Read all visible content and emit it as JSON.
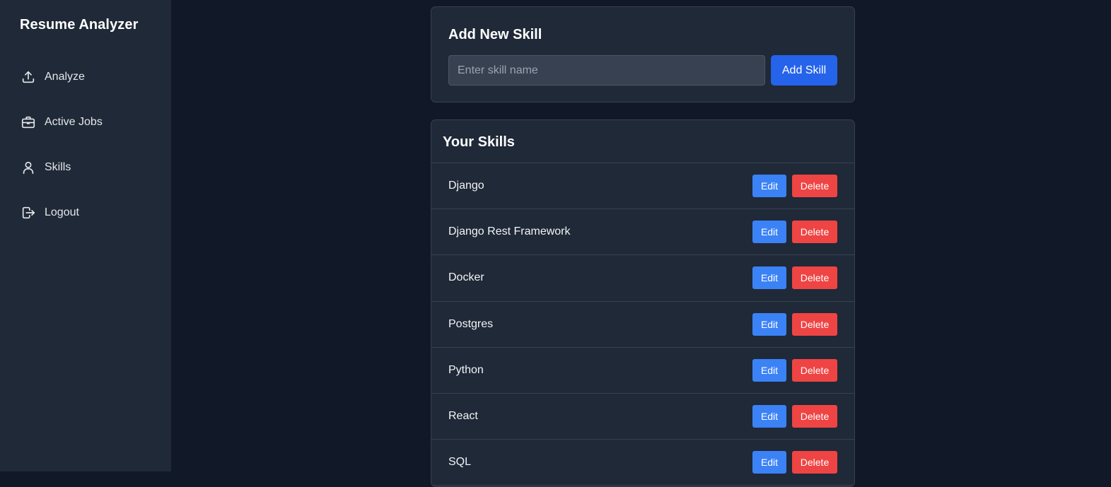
{
  "sidebar": {
    "brand": "Resume Analyzer",
    "items": [
      {
        "label": "Analyze",
        "icon": "upload-icon"
      },
      {
        "label": "Active Jobs",
        "icon": "briefcase-icon"
      },
      {
        "label": "Skills",
        "icon": "user-icon"
      },
      {
        "label": "Logout",
        "icon": "logout-icon"
      }
    ]
  },
  "add_skill": {
    "title": "Add New Skill",
    "input_value": "",
    "input_placeholder": "Enter skill name",
    "button_label": "Add Skill"
  },
  "skills": {
    "title": "Your Skills",
    "edit_label": "Edit",
    "delete_label": "Delete",
    "items": [
      "Django",
      "Django Rest Framework",
      "Docker",
      "Postgres",
      "Python",
      "React",
      "SQL"
    ]
  },
  "colors": {
    "background": "#111827",
    "panel": "#1f2937",
    "primary": "#2563eb",
    "edit": "#3b82f6",
    "delete": "#ef4444"
  }
}
